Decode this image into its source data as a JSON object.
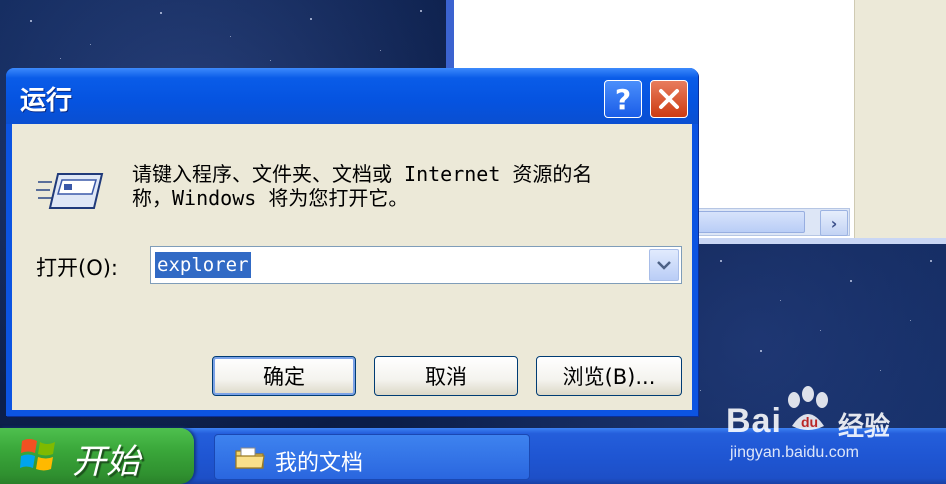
{
  "dialog": {
    "title": "运行",
    "help_icon": "help-icon",
    "close_icon": "close-icon",
    "description_line1": "请键入程序、文件夹、文档或 Internet 资源的名",
    "description_line2": "称，Windows 将为您打开它。",
    "open_label": "打开(O):",
    "open_value": "explorer",
    "ok_label": "确定",
    "cancel_label": "取消",
    "browse_label": "浏览(B)..."
  },
  "taskbar": {
    "start_label": "开始",
    "task_label": "我的文档"
  },
  "watermark": {
    "brand": "Bai",
    "brand_suffix": "经验",
    "url": "jingyan.baidu.com"
  },
  "colors": {
    "titlebar": "#0553e0",
    "dialog_bg": "#ece9d8",
    "taskbar": "#245edb",
    "start_green": "#3aa73a",
    "selection": "#316ac5"
  }
}
